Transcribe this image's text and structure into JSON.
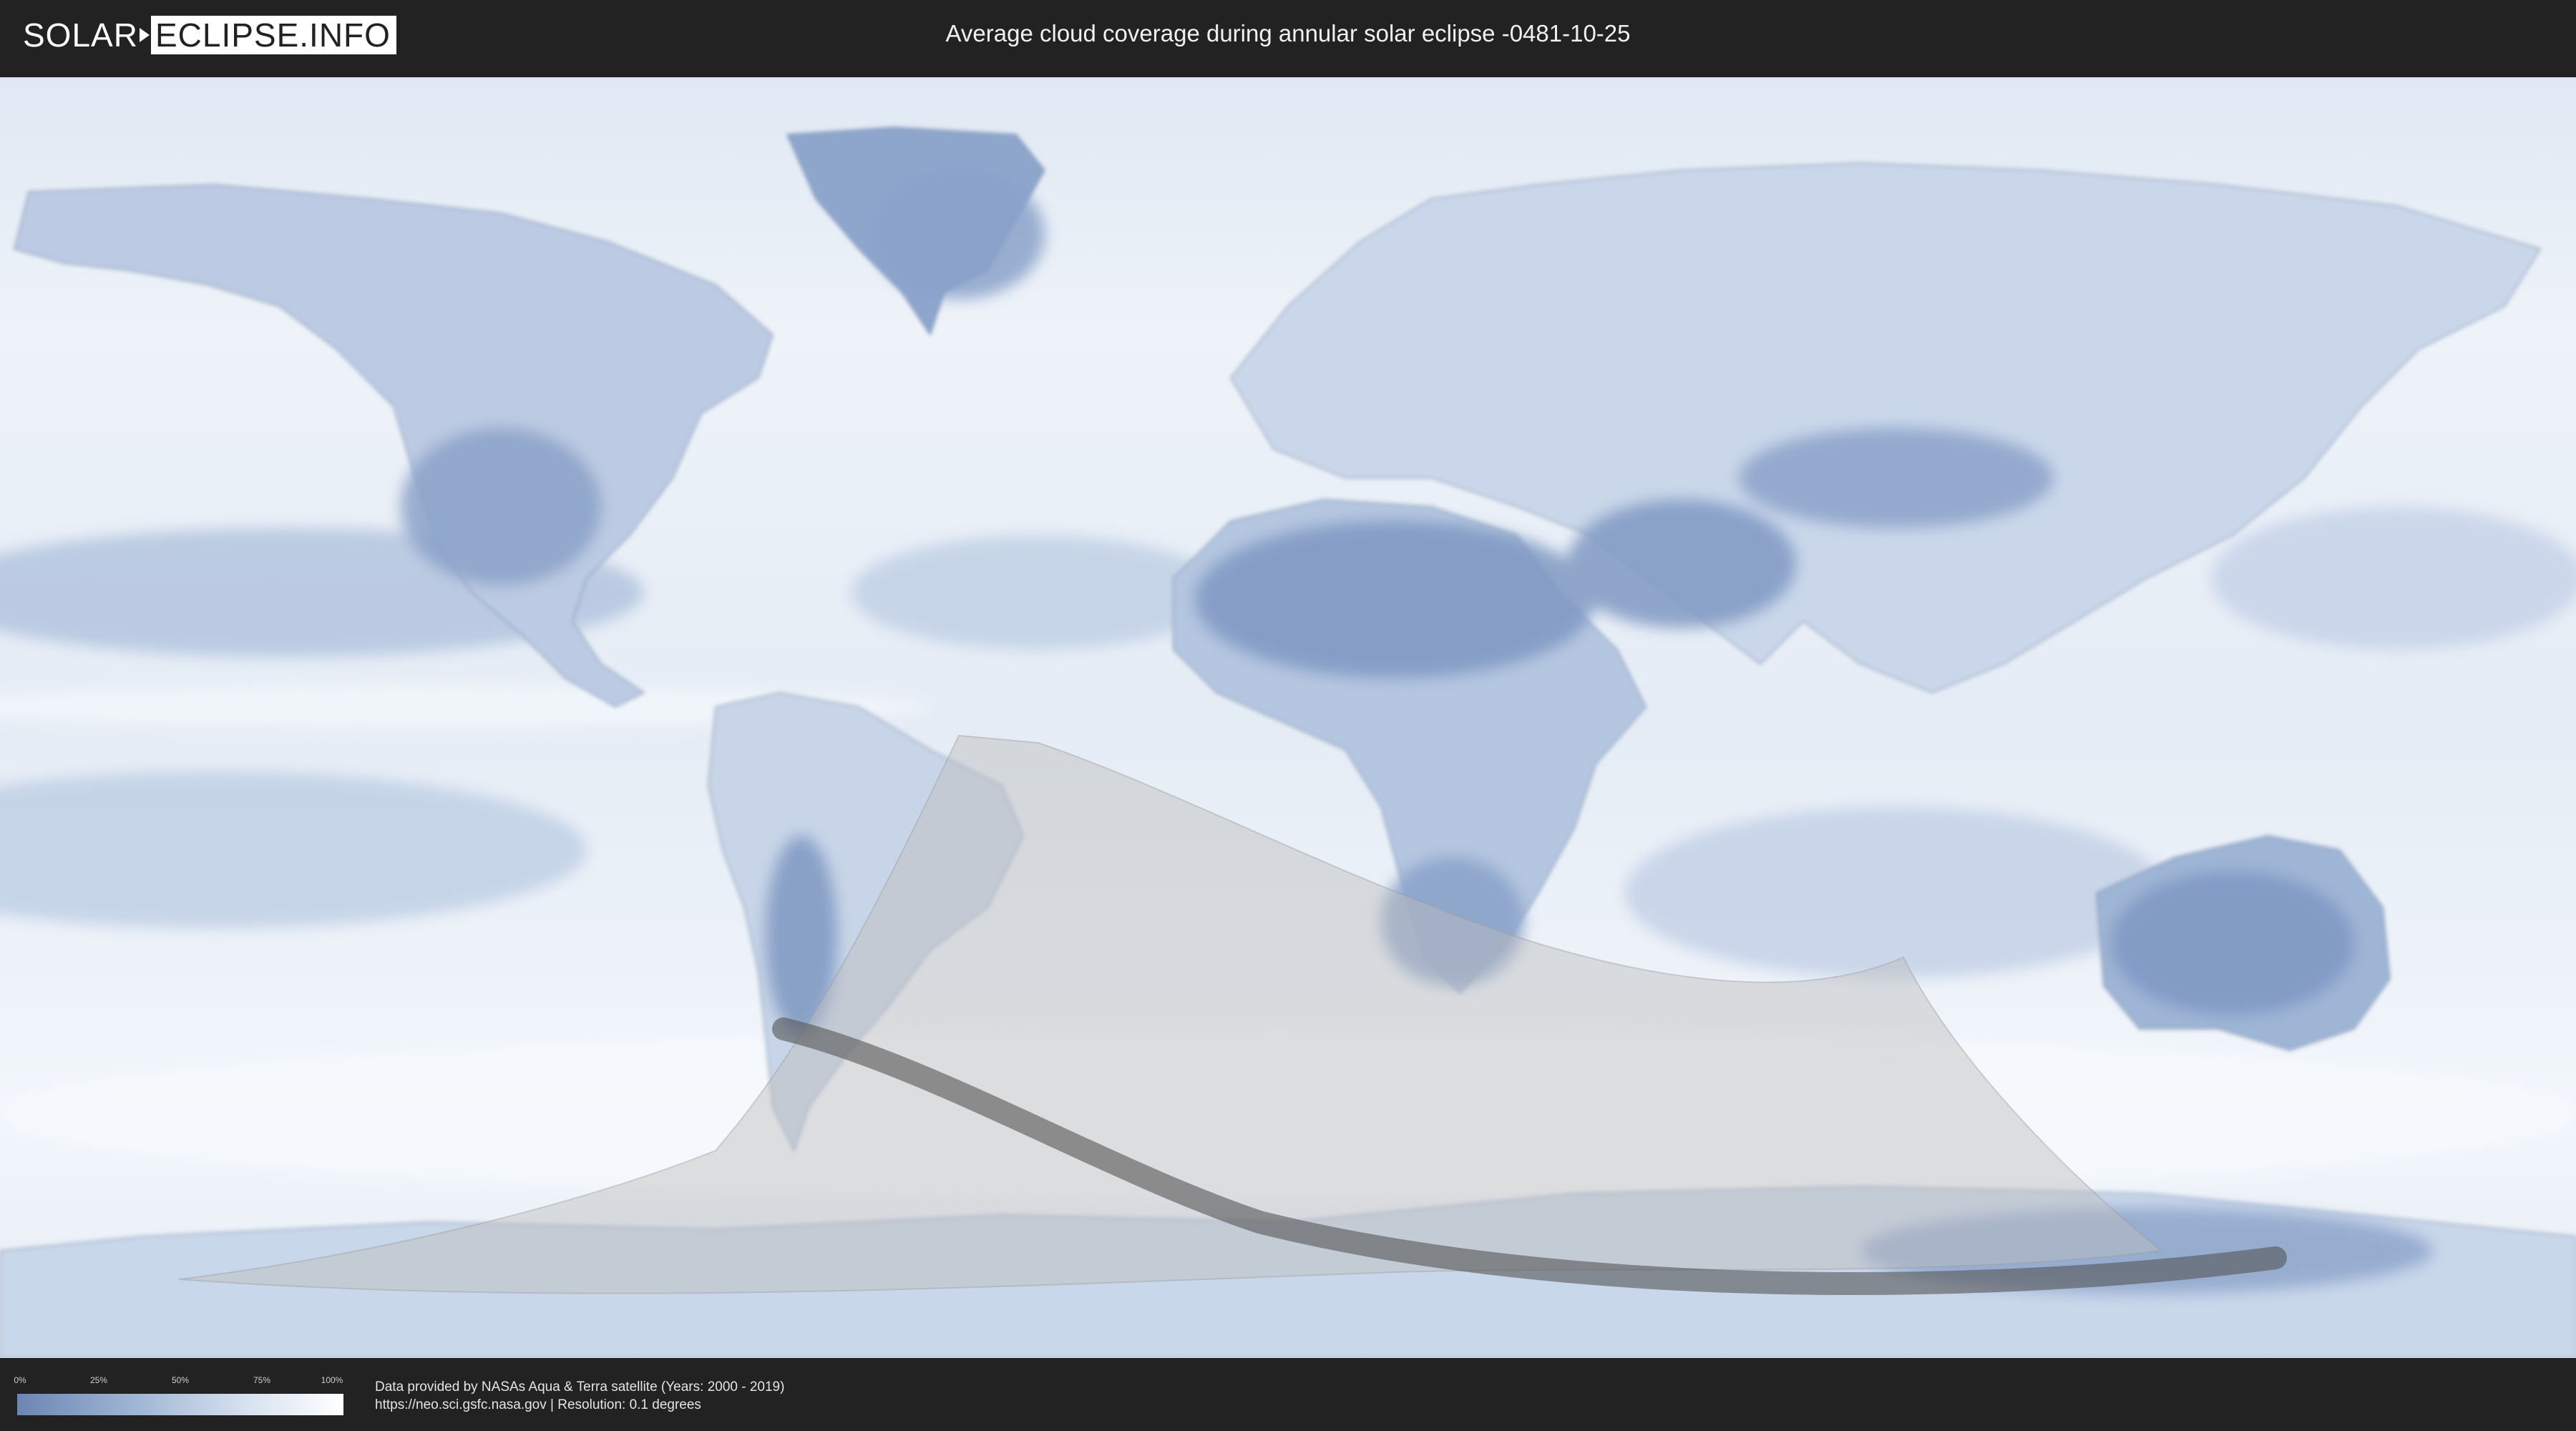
{
  "header": {
    "logo_left": "SOLAR",
    "logo_right": "ECLIPSE.INFO",
    "title": "Average cloud coverage during annular solar eclipse -0481-10-25"
  },
  "legend": {
    "ticks": [
      "0%",
      "25%",
      "50%",
      "75%",
      "100%"
    ],
    "gradient_colors": [
      "#6c86b2",
      "#9eb4d4",
      "#d6e1ef",
      "#ffffff"
    ]
  },
  "credits": {
    "line1": "Data provided by NASAs Aqua & Terra satellite (Years: 2000 - 2019)",
    "line2": "https://neo.sci.gsfc.nasa.gov | Resolution: 0.1 degrees"
  },
  "colors": {
    "background": "#222222",
    "land_clear": "#7d96bf",
    "cloud": "#eef3f9",
    "eclipse_zone": "#bdbdbd",
    "annular_path": "#555555"
  }
}
